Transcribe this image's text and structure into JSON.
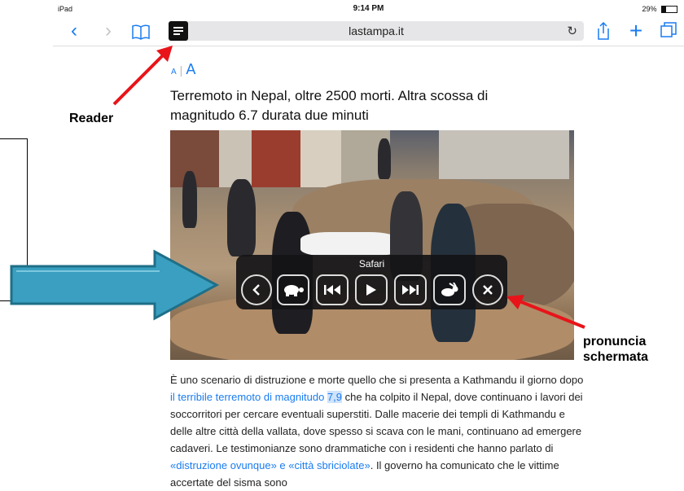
{
  "status_bar": {
    "device": "iPad",
    "time": "9:14 PM",
    "battery": "29%"
  },
  "navbar": {
    "back_glyph": "‹",
    "forward_glyph": "›",
    "bookmarks_icon": "book-icon",
    "url": "lastampa.it",
    "reload_glyph": "↻",
    "share_icon": "share-icon",
    "new_tab_glyph": "+",
    "tabs_icon": "tabs-icon"
  },
  "reader": {
    "font_small": "A",
    "font_large": "A"
  },
  "article": {
    "headline": "Terremoto in Nepal, oltre 2500 morti. Altra scossa di magnitudo 6.7 durata due minuti",
    "body_1": "È uno scenario di distruzione e morte quello che si presenta a Kathmandu il giorno dopo ",
    "link_1": "il terribile terremoto di magnitudo ",
    "link_1_highlight": "7,9",
    "body_2": " che ha colpito il Nepal, dove continuano i lavori dei soccorritori per cercare eventuali superstiti. Dalle macerie dei templi di Kathmandu e delle altre città della vallata, dove spesso si scava con le mani, continuano ad emergere cadaveri. Le testimonianze sono drammatiche con i residenti che hanno parlato di ",
    "link_2": "«distruzione ovunque» e «città sbriciolate»",
    "body_3": ". Il governo ha comunicato che le vittime accertate del sisma sono"
  },
  "speech_panel": {
    "title": "Safari",
    "buttons": [
      "collapse",
      "slower",
      "previous",
      "play",
      "next",
      "faster",
      "close"
    ]
  },
  "annotations": {
    "reader_label": "Reader",
    "speak_label_1": "pronuncia",
    "speak_label_2": "schermata",
    "colors": {
      "red_arrow": "#e8141a",
      "blue_arrow": "#3a9fc0"
    }
  }
}
